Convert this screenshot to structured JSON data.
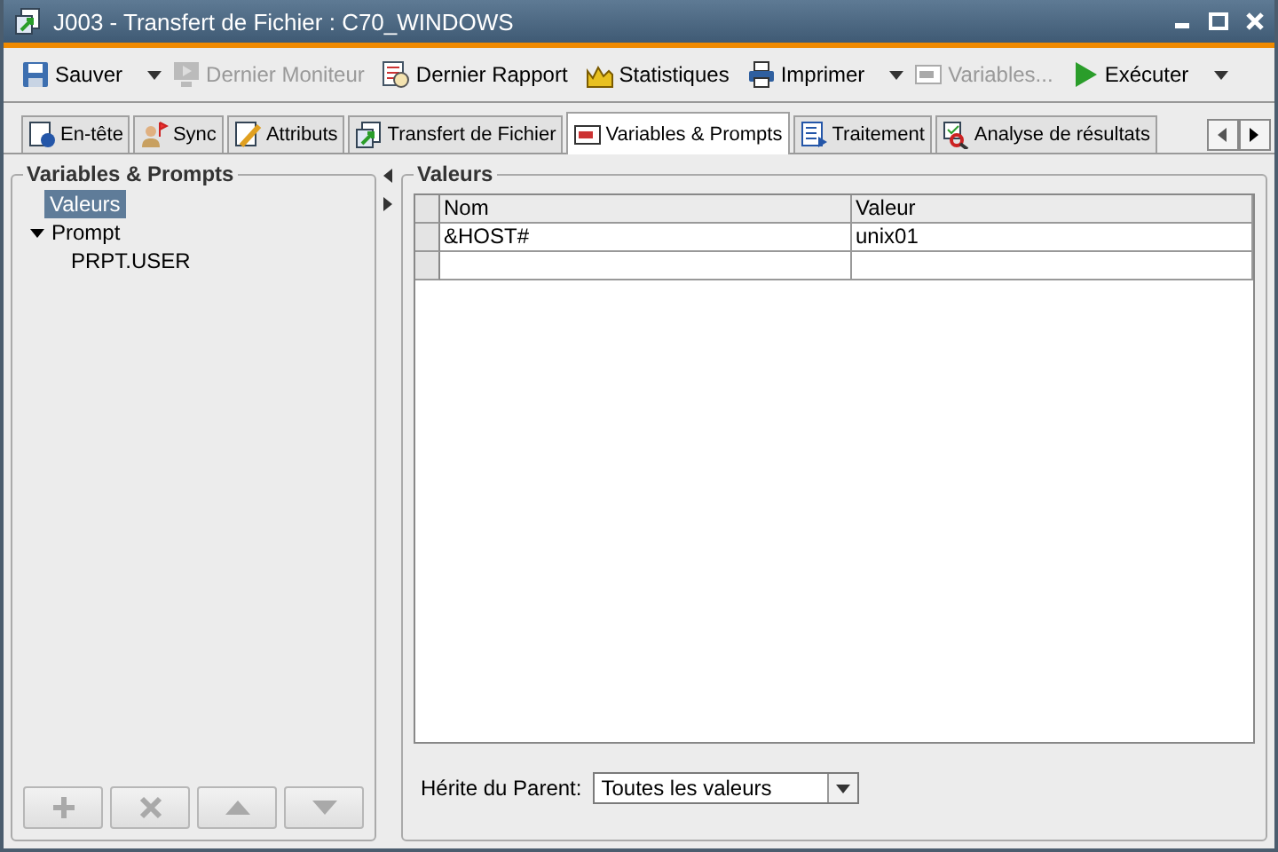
{
  "window": {
    "title": "J003 - Transfert de Fichier : C70_WINDOWS"
  },
  "toolbar": [
    {
      "label": "Sauver",
      "disabled": false,
      "dropdown": true
    },
    {
      "label": "Dernier Moniteur",
      "disabled": true,
      "dropdown": false
    },
    {
      "label": "Dernier Rapport",
      "disabled": false,
      "dropdown": false
    },
    {
      "label": "Statistiques",
      "disabled": false,
      "dropdown": false
    },
    {
      "label": "Imprimer",
      "disabled": false,
      "dropdown": true
    },
    {
      "label": "Variables...",
      "disabled": true,
      "dropdown": false
    },
    {
      "label": "Exécuter",
      "disabled": false,
      "dropdown": true
    }
  ],
  "tabs": [
    {
      "label": "En-tête",
      "selected": false
    },
    {
      "label": "Sync",
      "selected": false
    },
    {
      "label": "Attributs",
      "selected": false
    },
    {
      "label": "Transfert de Fichier",
      "selected": false
    },
    {
      "label": "Variables & Prompts",
      "selected": true
    },
    {
      "label": "Traitement",
      "selected": false
    },
    {
      "label": "Analyse de résultats",
      "selected": false
    }
  ],
  "sidebar": {
    "title": "Variables & Prompts",
    "items": [
      {
        "label": "Valeurs",
        "selected": true
      },
      {
        "label": "Prompt",
        "selected": false,
        "expanded": true,
        "children": [
          {
            "label": "PRPT.USER",
            "selected": false
          }
        ]
      }
    ],
    "buttons": [
      {
        "kind": "add",
        "disabled": true
      },
      {
        "kind": "delete",
        "disabled": true
      },
      {
        "kind": "up",
        "disabled": true
      },
      {
        "kind": "down",
        "disabled": true
      }
    ]
  },
  "values": {
    "title": "Valeurs",
    "table": {
      "columns": [
        "Nom",
        "Valeur"
      ],
      "rows": [
        [
          "&HOST#",
          "unix01"
        ]
      ]
    },
    "inherit": {
      "label": "Hérite du Parent:",
      "value": "Toutes les valeurs"
    }
  }
}
